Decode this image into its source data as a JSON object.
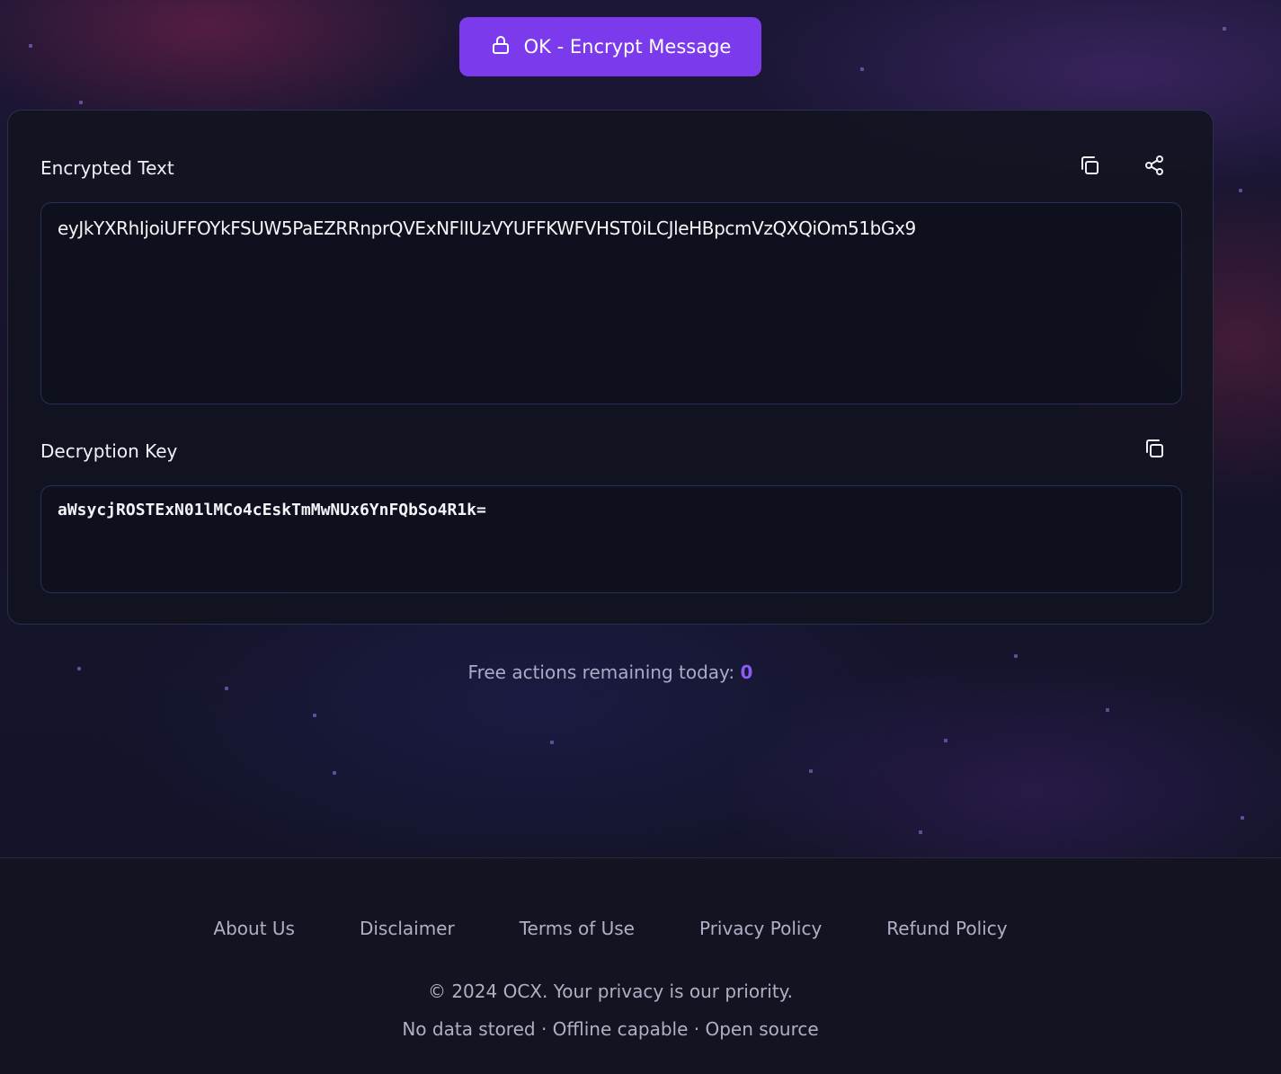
{
  "action_button": {
    "label": "OK - Encrypt Message",
    "icon": "lock-icon"
  },
  "encrypted": {
    "label": "Encrypted Text",
    "value": "eyJkYXRhIjoiUFFOYkFSUW5PaEZRRnprQVExNFlIUzVYUFFKWFVHST0iLCJleHBpcmVzQXQiOm51bGx9",
    "copy_icon": "copy-icon",
    "share_icon": "share-icon"
  },
  "key": {
    "label": "Decryption Key",
    "value": "aWsycjROSTExN01lMCo4cEskTmMwNUx6YnFQbSo4R1k=",
    "copy_icon": "copy-icon"
  },
  "status": {
    "free_actions_text": "Free actions remaining today:",
    "free_actions_count": "0"
  },
  "footer": {
    "links": [
      "About Us",
      "Disclaimer",
      "Terms of Use",
      "Privacy Policy",
      "Refund Policy"
    ],
    "copyright": "© 2024 OCX. Your privacy is our priority.",
    "tagline": "No data stored · Offline capable · Open source"
  },
  "colors": {
    "accent": "#7c3aed",
    "count": "#8b5cf6",
    "background": "#15132a"
  }
}
